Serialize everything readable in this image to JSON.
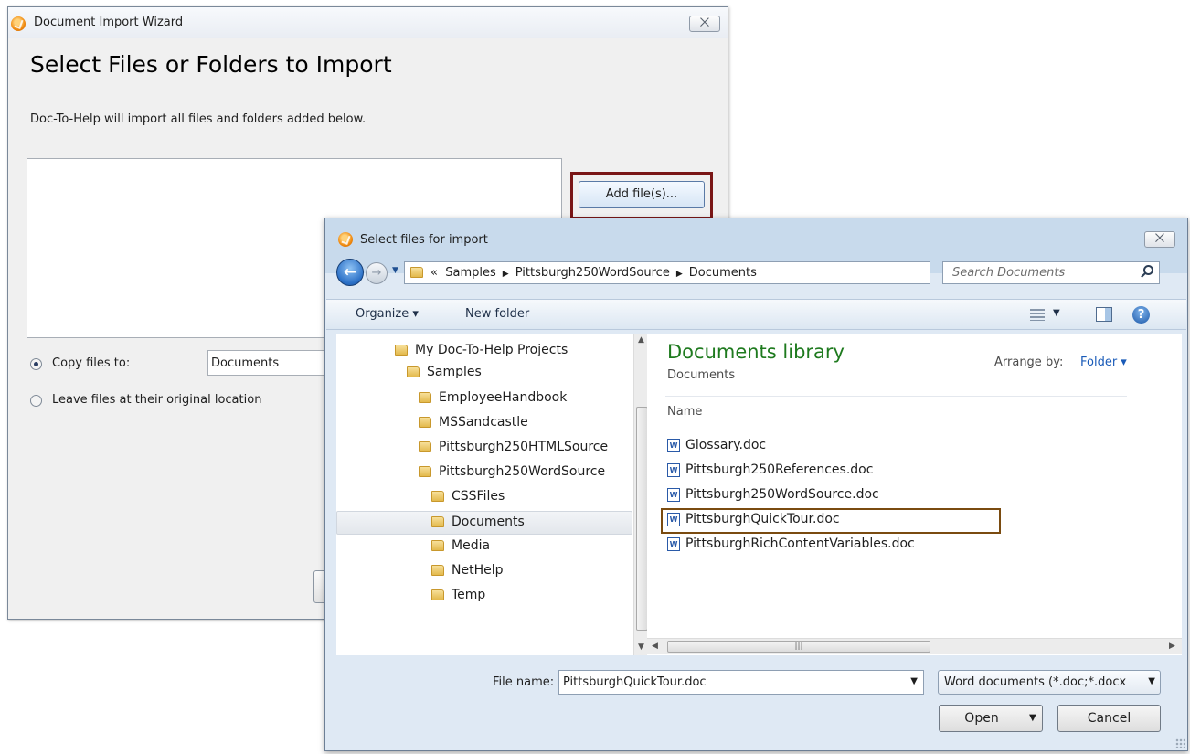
{
  "wizard": {
    "title": "Document Import Wizard",
    "close_label": "⨉",
    "heading": "Select Files or Folders to Import",
    "description": "Doc-To-Help will import all files and folders added below.",
    "add_button": "Add file(s)...",
    "copy_option": "Copy files to:",
    "copy_value": "Documents",
    "leave_option": "Leave files at their original location"
  },
  "dialog": {
    "title": "Select files for import",
    "close_label": "⨉",
    "address": {
      "prefix": "«",
      "crumbs": [
        "Samples",
        "Pittsburgh250WordSource",
        "Documents"
      ]
    },
    "search_placeholder": "Search Documents",
    "toolbar": {
      "organize": "Organize ▾",
      "new_folder": "New folder",
      "help": "?"
    },
    "tree": [
      {
        "label": "My Doc-To-Help Projects",
        "level": 0
      },
      {
        "label": "Samples",
        "level": 1
      },
      {
        "label": "EmployeeHandbook",
        "level": 2
      },
      {
        "label": "MSSandcastle",
        "level": 2
      },
      {
        "label": "Pittsburgh250HTMLSource",
        "level": 2
      },
      {
        "label": "Pittsburgh250WordSource",
        "level": 2
      },
      {
        "label": "CSSFiles",
        "level": 3
      },
      {
        "label": "Documents",
        "level": 3,
        "selected": true
      },
      {
        "label": "Media",
        "level": 3
      },
      {
        "label": "NetHelp",
        "level": 3
      },
      {
        "label": "Temp",
        "level": 3
      }
    ],
    "library_title": "Documents library",
    "library_subtitle": "Documents",
    "arrange_label": "Arrange by:",
    "arrange_value": "Folder ▾",
    "column_name": "Name",
    "files": [
      "Glossary.doc",
      "Pittsburgh250References.doc",
      "Pittsburgh250WordSource.doc",
      "PittsburghQuickTour.doc",
      "PittsburghRichContentVariables.doc"
    ],
    "selected_file": "PittsburghQuickTour.doc",
    "file_name_label": "File name:",
    "file_name_value": "PittsburghQuickTour.doc",
    "file_type": "Word documents (*.doc;*.docx",
    "open_label": "Open",
    "cancel_label": "Cancel"
  }
}
